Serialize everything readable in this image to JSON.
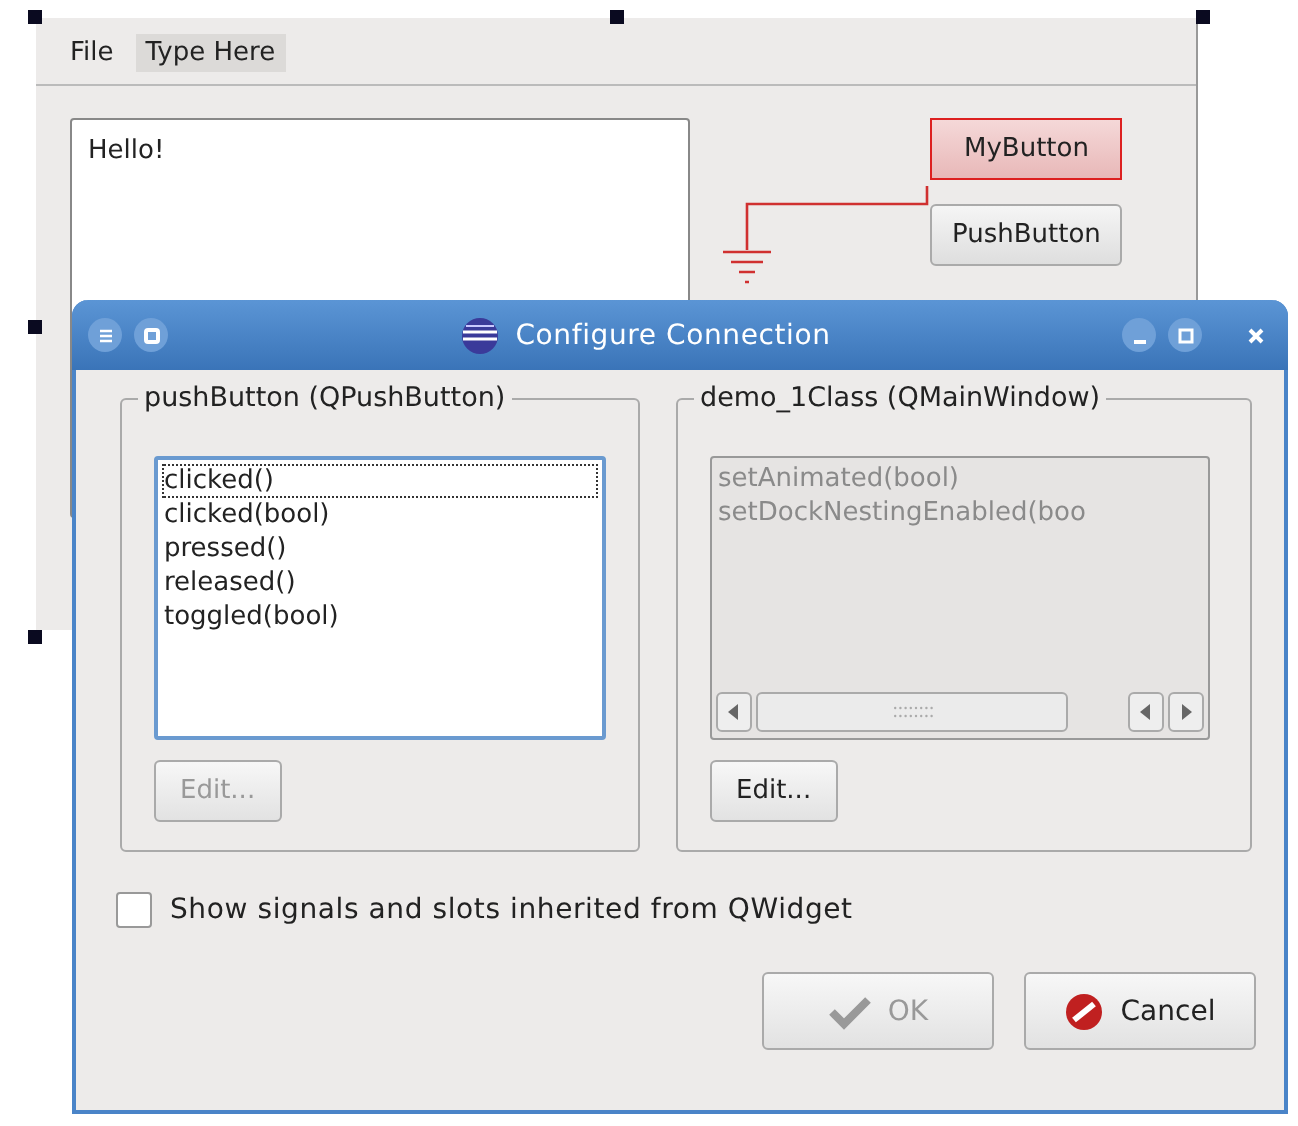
{
  "form": {
    "menu": [
      {
        "label": "File",
        "selected": false
      },
      {
        "label": "Type Here",
        "selected": true
      }
    ],
    "text_edit": {
      "value": "Hello!"
    },
    "buttons": [
      {
        "label": "MyButton",
        "selected": true
      },
      {
        "label": "PushButton",
        "selected": false
      }
    ]
  },
  "dialog": {
    "title": "Configure Connection",
    "sender": {
      "title": "pushButton (QPushButton)",
      "disabled": false,
      "items": [
        {
          "label": "clicked()",
          "selected": true
        },
        {
          "label": "clicked(bool)",
          "selected": false
        },
        {
          "label": "pressed()",
          "selected": false
        },
        {
          "label": "released()",
          "selected": false
        },
        {
          "label": "toggled(bool)",
          "selected": false
        }
      ],
      "edit_button": {
        "label": "Edit...",
        "disabled": true
      }
    },
    "receiver": {
      "title": "demo_1Class (QMainWindow)",
      "disabled": true,
      "items": [
        {
          "label": "setAnimated(bool)",
          "selected": false
        },
        {
          "label": "setDockNestingEnabled(boo",
          "selected": false
        }
      ],
      "edit_button": {
        "label": "Edit...",
        "disabled": false
      }
    },
    "checkbox": {
      "label": "Show signals and slots inherited from QWidget",
      "checked": false
    },
    "buttons": [
      {
        "label": "OK",
        "kind": "ok",
        "disabled": true
      },
      {
        "label": "Cancel",
        "kind": "cancel",
        "disabled": false
      }
    ]
  }
}
